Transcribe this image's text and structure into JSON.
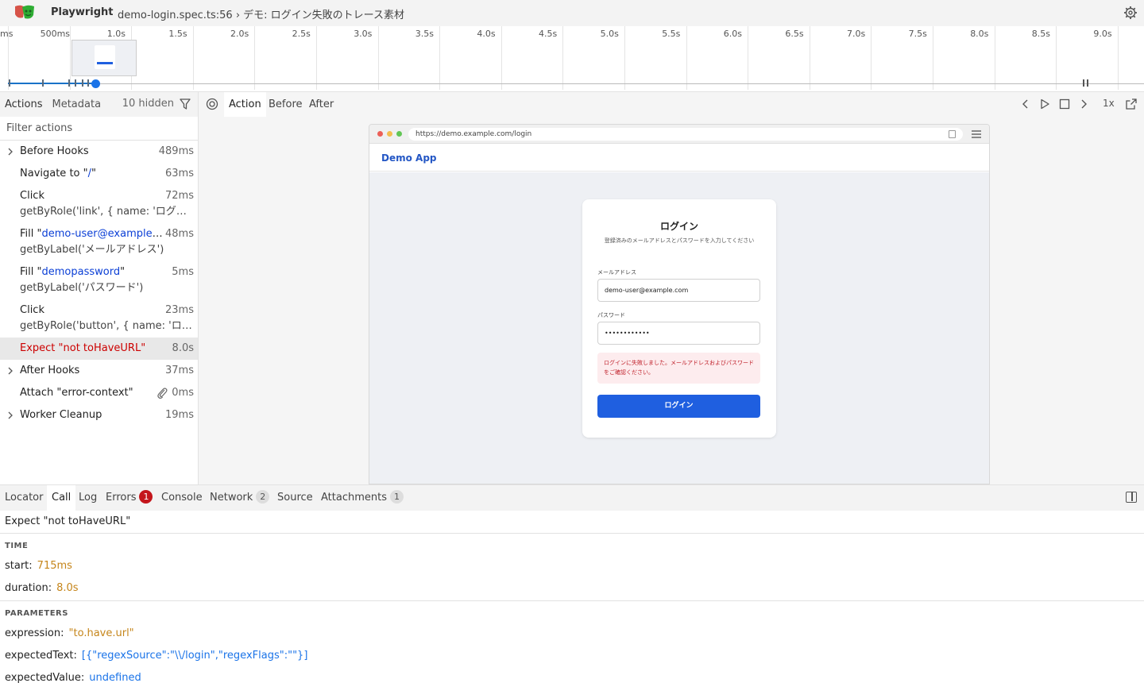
{
  "titlebar": {
    "app_name": "Playwright",
    "trace_title": "demo-login.spec.ts:56 › デモ: ログイン失敗のトレース素材"
  },
  "timeline": {
    "labels": [
      "ms",
      "500ms",
      "1.0s",
      "1.5s",
      "2.0s",
      "2.5s",
      "3.0s",
      "3.5s",
      "4.0s",
      "4.5s",
      "5.0s",
      "5.5s",
      "6.0s",
      "6.5s",
      "7.0s",
      "7.5s",
      "8.0s",
      "8.5s",
      "9.0s"
    ]
  },
  "actions_panel": {
    "tabs": [
      "Actions",
      "Metadata"
    ],
    "hidden_count": "10 hidden",
    "filter_placeholder": "Filter actions",
    "items": [
      {
        "title": "Before Hooks",
        "time": "489ms"
      },
      {
        "title_prefix": "Navigate to \"",
        "title_value": "/",
        "title_suffix": "\"",
        "time": "63ms"
      },
      {
        "title": "Click",
        "sub": "getByRole('link', { name: 'ログイン...",
        "time": "72ms"
      },
      {
        "title_prefix": "Fill \"",
        "title_value": "demo-user@example.c...",
        "title_suffix": "",
        "sub": "getByLabel('メールアドレス')",
        "time": "48ms"
      },
      {
        "title_prefix": "Fill \"",
        "title_value": "demopassword",
        "title_suffix": "\"",
        "sub": "getByLabel('パスワード')",
        "time": "5ms"
      },
      {
        "title": "Click",
        "sub": "getByRole('button', { name: 'ログイ...",
        "time": "23ms"
      },
      {
        "title": "Expect \"not toHaveURL\"",
        "time": "8.0s"
      },
      {
        "title": "After Hooks",
        "time": "37ms"
      },
      {
        "title": "Attach \"error-context\"",
        "time": "0ms"
      },
      {
        "title": "Worker Cleanup",
        "time": "19ms"
      }
    ]
  },
  "snapshot": {
    "tabs": [
      "Action",
      "Before",
      "After"
    ],
    "speed": "1x",
    "url": "https://demo.example.com/login",
    "app_title": "Demo App",
    "login": {
      "title": "ログイン",
      "subtitle": "登録済みのメールアドレスとパスワードを入力してください",
      "email_label": "メールアドレス",
      "email_value": "demo-user@example.com",
      "password_label": "パスワード",
      "password_value": "••••••••••••",
      "error": "ログインに失敗しました。メールアドレスおよびパスワードをご確認ください。",
      "button": "ログイン"
    }
  },
  "details": {
    "tabs": {
      "locator": "Locator",
      "call": "Call",
      "log": "Log",
      "errors": "Errors",
      "errors_count": "1",
      "console": "Console",
      "network": "Network",
      "network_count": "2",
      "source": "Source",
      "attachments": "Attachments",
      "attachments_count": "1"
    },
    "call_title": "Expect \"not toHaveURL\"",
    "time_header": "TIME",
    "start_label": "start:",
    "start_value": "715ms",
    "duration_label": "duration:",
    "duration_value": "8.0s",
    "params_header": "PARAMETERS",
    "expression_label": "expression:",
    "expression_value": "\"to.have.url\"",
    "expected_text_label": "expectedText:",
    "expected_text_value": "[{\"regexSource\":\"\\\\/login\",\"regexFlags\":\"\"}]",
    "expected_value_label": "expectedValue:",
    "expected_value_value": "undefined"
  },
  "colors": {
    "accent": "#1a73e8",
    "error": "#c4161c",
    "value_orange": "#c5851a",
    "login_button": "#1f5fe0"
  }
}
